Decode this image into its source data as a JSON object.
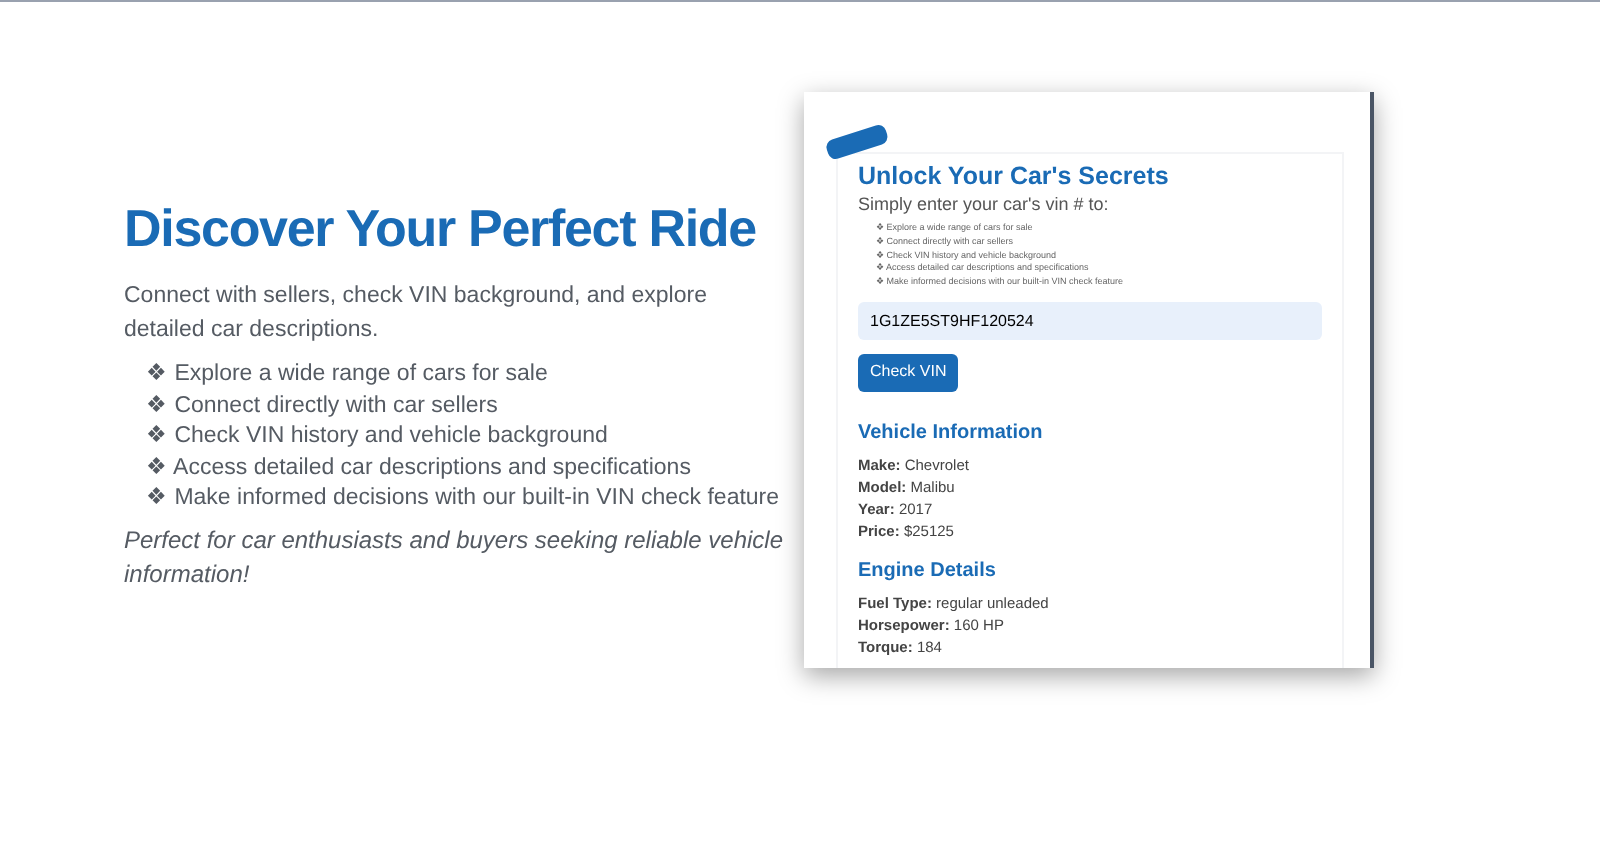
{
  "hero": {
    "title": "Discover Your Perfect Ride",
    "intro": "Connect with sellers, check VIN background, and explore detailed car descriptions.",
    "features": [
      "❖ Explore a wide range of cars for sale",
      "❖ Connect directly with car sellers",
      "❖ Check VIN history and vehicle background",
      "❖ Access detailed car descriptions and specifications",
      "❖ Make informed decisions with our built-in VIN check feature"
    ],
    "tagline": "Perfect for car enthusiasts and buyers seeking reliable vehicle information!"
  },
  "preview": {
    "title": "Unlock Your Car's Secrets",
    "subtitle": "Simply enter your car's vin # to:",
    "features": [
      "❖ Explore a wide range of cars for sale",
      "❖ Connect directly with car sellers",
      "❖ Check VIN history and vehicle background",
      "❖ Access detailed car descriptions and specifications",
      "❖ Make informed decisions with our built-in VIN check feature"
    ],
    "vin_field": {
      "value": "1G1ZE5ST9HF120524"
    },
    "button": "Check VIN",
    "sections": [
      {
        "heading": "Vehicle Information",
        "rows": [
          "**Make:** Chevrolet",
          "**Model:** Malibu",
          "**Year:** 2017",
          "**Price:** $25125"
        ]
      },
      {
        "heading": "Engine Details",
        "rows": [
          "**Fuel Type:** regular unleaded",
          "**Horsepower:** 160 HP",
          "**Torque:** 184"
        ]
      }
    ]
  }
}
